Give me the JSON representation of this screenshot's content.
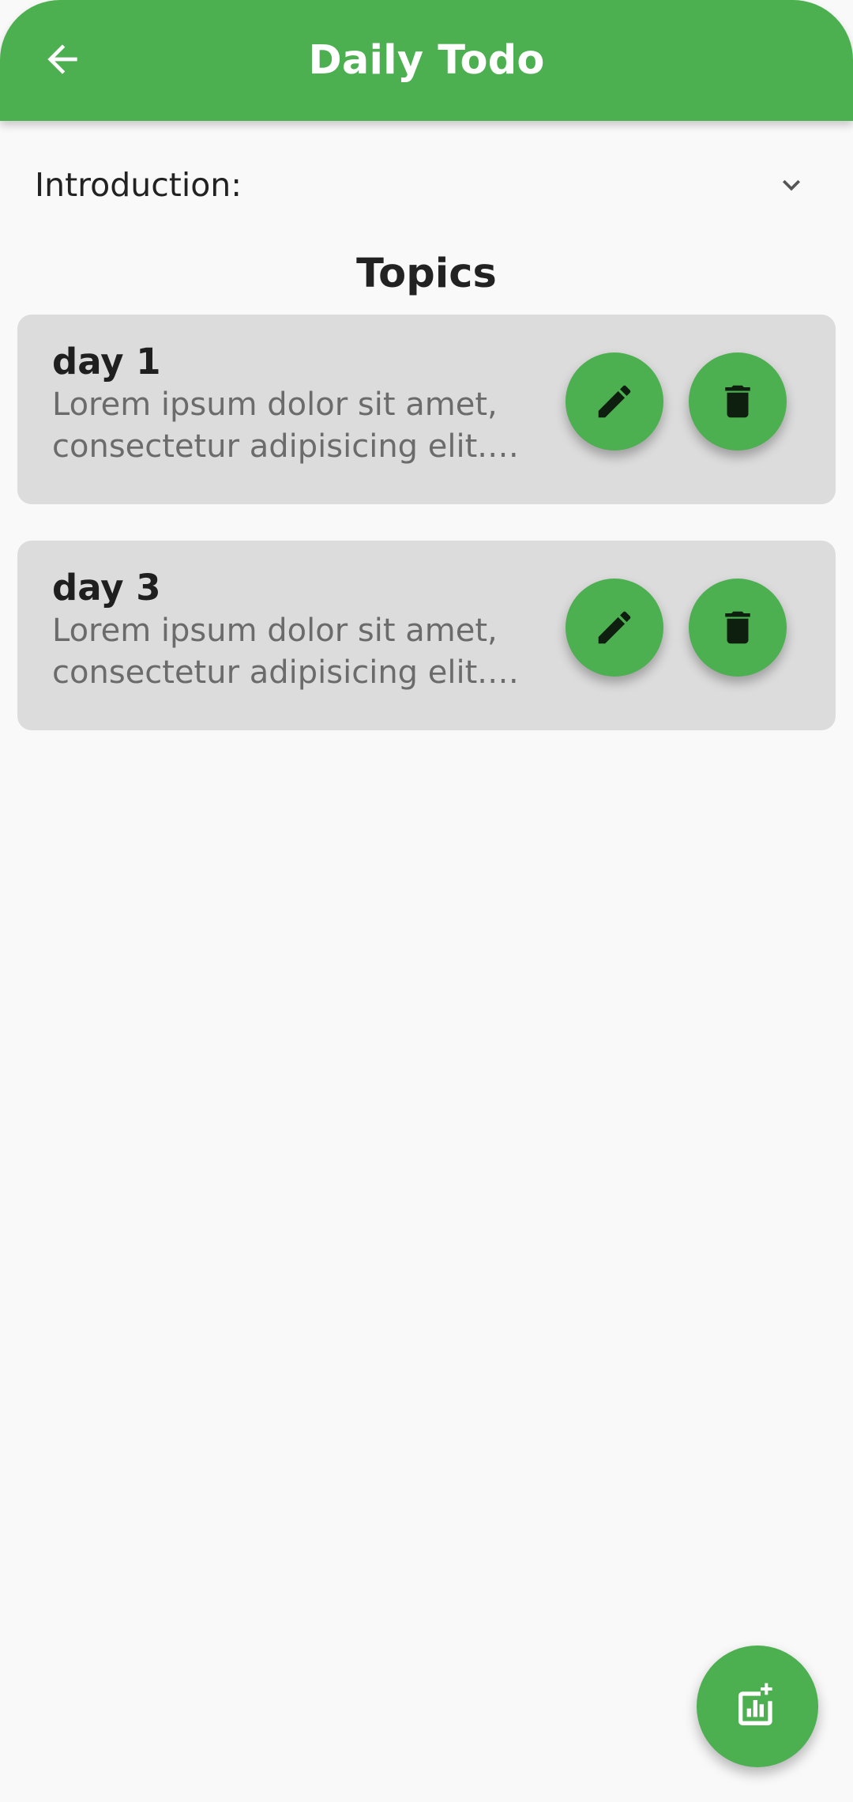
{
  "app_bar": {
    "title": "Daily Todo",
    "back_icon": "arrow-left-icon",
    "color": "#4caf50"
  },
  "introduction": {
    "label": "Introduction:",
    "expand_icon": "chevron-down-icon"
  },
  "section": {
    "title": "Topics"
  },
  "topics": [
    {
      "title": "day 1",
      "description": "Lorem ipsum dolor sit amet, consectetur adipisicing elit. Lorem ipsum dolor sit amet",
      "edit_icon": "pencil-icon",
      "delete_icon": "trash-icon"
    },
    {
      "title": "day 3",
      "description": "Lorem ipsum dolor sit amet, consectetur adipisicing elit. Lorem ipsum dolor sit amet",
      "edit_icon": "pencil-icon",
      "delete_icon": "trash-icon"
    }
  ],
  "fab": {
    "icon": "add-chart-icon"
  },
  "colors": {
    "accent": "#4caf50",
    "card_background": "#dcdcdc",
    "page_background": "#f9f9f9"
  }
}
